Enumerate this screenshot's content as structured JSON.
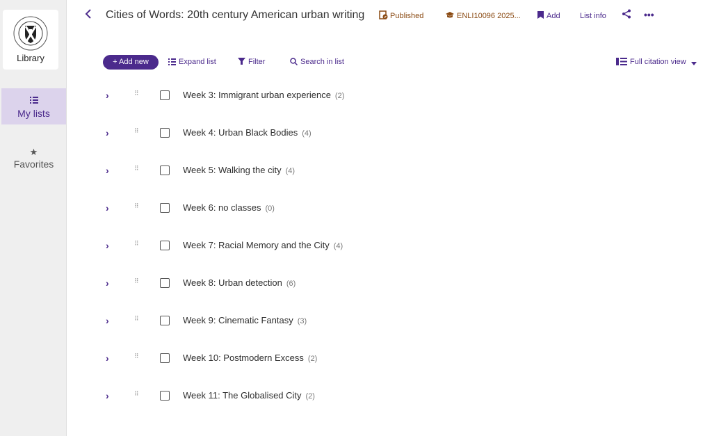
{
  "sidebar": {
    "logo_text": "Library",
    "items": [
      {
        "label": "My lists",
        "icon": "list-icon"
      },
      {
        "label": "Favorites",
        "icon": "star-icon"
      }
    ]
  },
  "header": {
    "title": "Cities of Words: 20th century American urban writing",
    "status": "Published",
    "course": "ENLI10096 2025...",
    "add_label": "Add",
    "list_info_label": "List info"
  },
  "toolbar": {
    "add_new": "+ Add new",
    "expand": "Expand list",
    "filter": "Filter",
    "search": "Search in list",
    "view": "Full citation view"
  },
  "sections": [
    {
      "label": "Week 3: Immigrant urban experience",
      "count": "(2)"
    },
    {
      "label": "Week 4: Urban Black Bodies",
      "count": "(4)"
    },
    {
      "label": "Week 5: Walking the city",
      "count": "(4)"
    },
    {
      "label": "Week 6: no classes",
      "count": "(0)"
    },
    {
      "label": "Week 7: Racial Memory and the City",
      "count": "(4)"
    },
    {
      "label": "Week 8: Urban detection",
      "count": "(6)"
    },
    {
      "label": "Week 9: Cinematic Fantasy",
      "count": "(3)"
    },
    {
      "label": "Week 10: Postmodern Excess",
      "count": "(2)"
    },
    {
      "label": "Week 11: The Globalised City",
      "count": "(2)"
    }
  ],
  "colors": {
    "accent": "#4b2a8c",
    "published": "#8a4a12",
    "sidebar_bg": "#efefef",
    "selected_bg": "#dcd3ec"
  }
}
